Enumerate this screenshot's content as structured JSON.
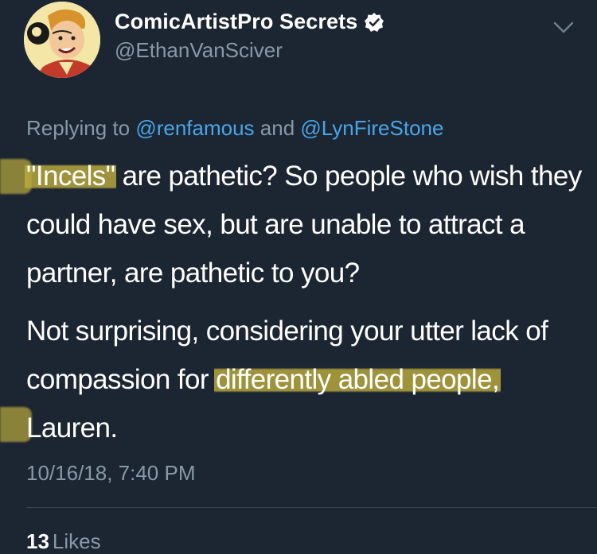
{
  "author": {
    "display_name": "ComicArtistPro Secrets",
    "handle": "@EthanVanSciver",
    "verified": true,
    "avatar_icon": "cartoon-avatar-icon"
  },
  "reply": {
    "prefix": "Replying to ",
    "mention1": "@renfamous",
    "joiner": " and ",
    "mention2": "@LynFireStone"
  },
  "body": {
    "p1_hl": "\"Incels\"",
    "p1_rest": " are pathetic?  So people who wish they could have sex, but are unable to attract a partner, are pathetic to you?",
    "p2_a": "Not surprising, considering your utter lack of compassion for ",
    "p2_hl": "differently abled people,",
    "p2_b": " Lauren."
  },
  "timestamp": "10/16/18, 7:40 PM",
  "stats": {
    "likes_count": "13",
    "likes_label": "Likes"
  },
  "colors": {
    "background": "#1c2632",
    "link": "#4aa5e8",
    "muted": "#8899a6",
    "highlight": "#baaa3c"
  }
}
